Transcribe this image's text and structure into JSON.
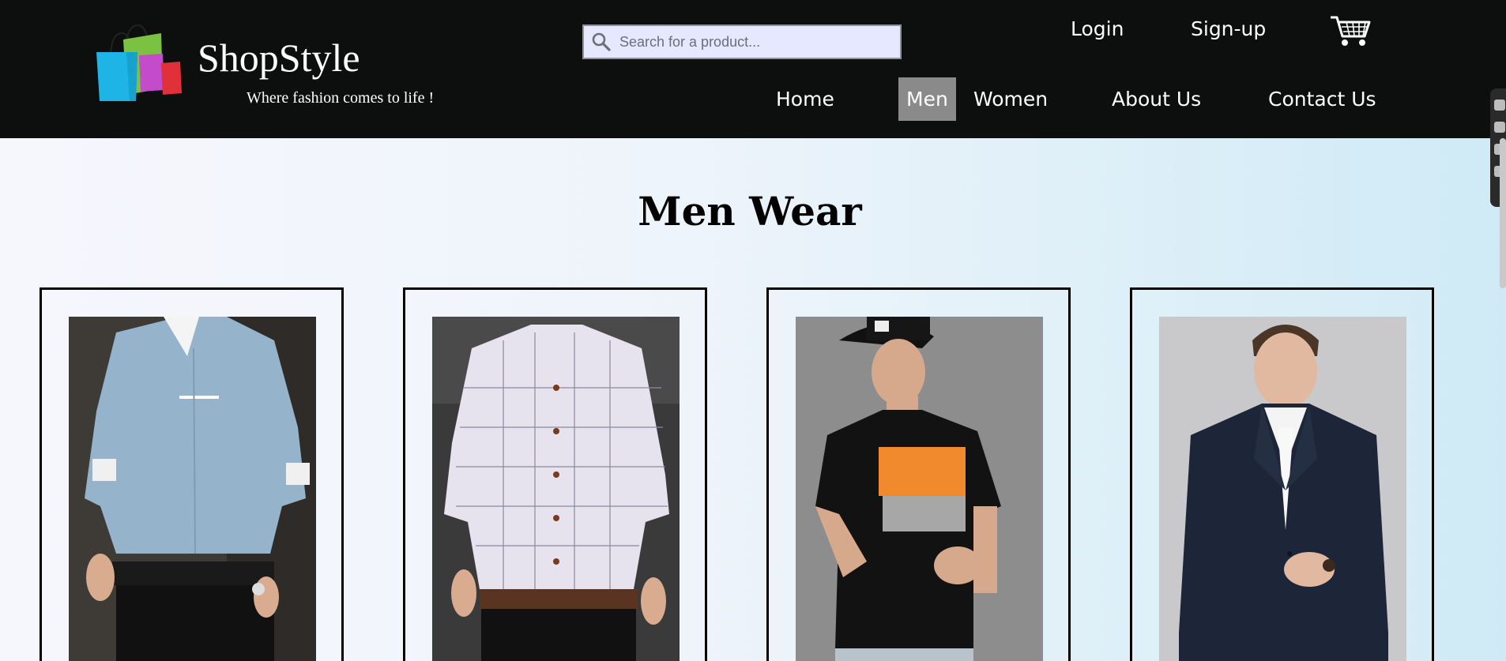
{
  "header": {
    "brand": "ShopStyle",
    "tagline": "Where fashion comes to life !",
    "search": {
      "placeholder": "Search for a product...",
      "value": ""
    },
    "auth": {
      "login": "Login",
      "signup": "Sign-up"
    },
    "icons": {
      "logo": "shopping-bags-logo",
      "search": "search-icon",
      "cart": "cart-icon"
    },
    "nav": [
      {
        "label": "Home",
        "active": false
      },
      {
        "label": "Men",
        "active": true
      },
      {
        "label": "Women",
        "active": false
      },
      {
        "label": "About Us",
        "active": false
      },
      {
        "label": "Contact Us",
        "active": false
      }
    ]
  },
  "main": {
    "title": "Men Wear",
    "products": [
      {
        "image": "light-blue-shirt"
      },
      {
        "image": "checked-white-shirt"
      },
      {
        "image": "black-graphic-tshirt"
      },
      {
        "image": "navy-blazer"
      }
    ]
  },
  "colors": {
    "header_bg": "#0d0f0f",
    "active_nav_bg": "#8a8a8a",
    "search_bg": "#e6e8ff",
    "text_dark": "#000000",
    "text_light": "#ffffff"
  }
}
